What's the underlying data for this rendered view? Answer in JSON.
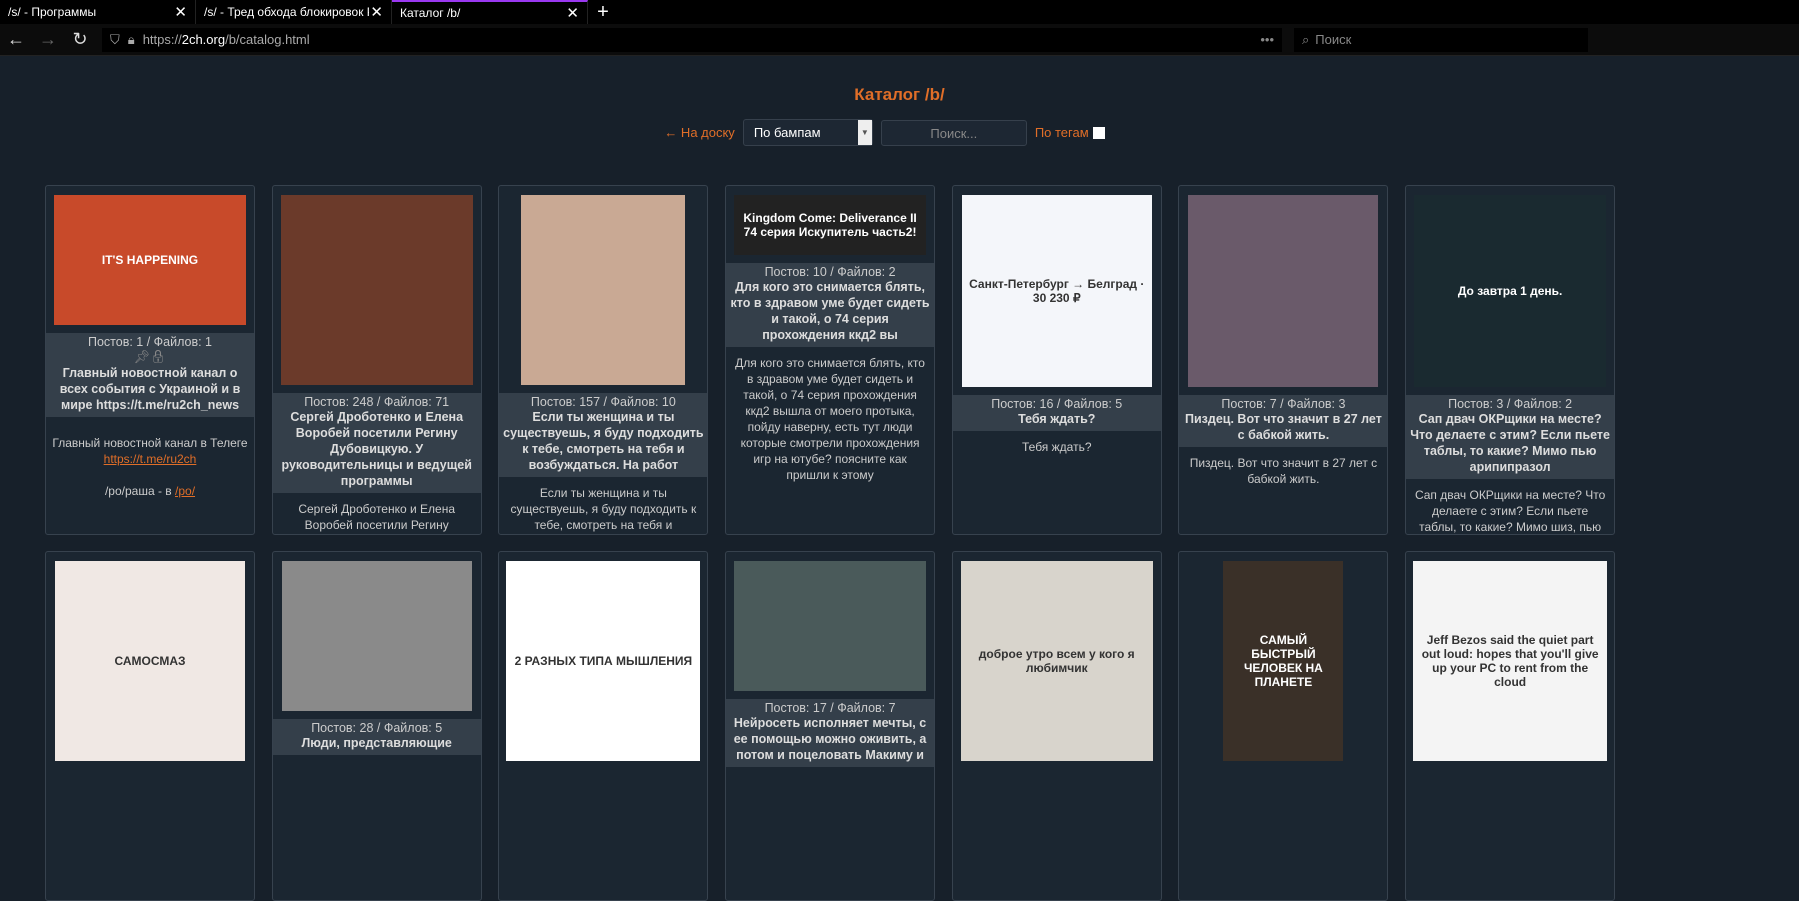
{
  "browser": {
    "tabs": [
      {
        "label": "/s/ - Программы"
      },
      {
        "label": "/s/ - Тред обхода блокировок PKH"
      },
      {
        "label": "Каталог /b/"
      }
    ],
    "url_prefix": "https://",
    "url_host": "2ch.org",
    "url_path": "/b/catalog.html",
    "search_placeholder": "Поиск",
    "close": "✕",
    "newtab": "+",
    "more": "•••"
  },
  "page": {
    "title": "Каталог /b/",
    "back_link": "← На доску",
    "sort_value": "По бампам",
    "search_placeholder": "Поиск...",
    "tags_label": "По тегам"
  },
  "threads": [
    {
      "meta": "Постов: 1 / Файлов: 1",
      "title": "Главный новостной канал о всех события с Украиной и в мире https://t.me/ru2ch_news",
      "body1": "Главный новостной канал в Телеге ",
      "link1": "https://t.me/ru2ch",
      "body2": "/ро/раша - в ",
      "link2": "/po/",
      "img_color": "#c84a2a",
      "img_text": "IT'S HAPPENING"
    },
    {
      "meta": "Постов: 248 / Файлов: 71",
      "title": "Сергей Дроботенко и Елена Воробей посетили Регину Дубовицкую. У руководительницы и ведущей программы",
      "body": "Сергей Дроботенко и Елена Воробей посетили Регину Дубовицкую. У руководительницы и ведущей",
      "img_color": "#6b3a2a"
    },
    {
      "meta": "Постов: 157 / Файлов: 10",
      "title": "Если ты женщина и ты существуешь, я буду подходить к тебе, смотреть на тебя и возбуждаться. На работ",
      "body": "Если ты женщина и ты существуешь, я буду подходить к тебе, смотреть на тебя и возбуждаться",
      "img_color": "#c9a994"
    },
    {
      "meta": "Постов: 10 / Файлов: 2",
      "title": "Для кого это снимается блять, кто в здравом уме будет сидеть и такой, о 74 серия прохождения ккд2 вы",
      "body": "Для кого это снимается блять, кто в здравом уме будет сидеть и такой, о 74 серия прохождения ккд2 вышла от моего протыка, пойду наверну, есть тут люди которые смотрели прохождения игр на ютубе? поясните как пришли к этому",
      "img_color": "#222",
      "img_text": "Kingdom Come: Deliverance II 74 серия Искупитель часть2!"
    },
    {
      "meta": "Постов: 16 / Файлов: 5",
      "title": "Тебя ждать?",
      "body": "Тебя ждать?",
      "img_color": "#f4f6fa",
      "img_text": "Санкт-Петербург → Белград · 30 230 ₽"
    },
    {
      "meta": "Постов: 7 / Файлов: 3",
      "title": "Пиздец. Вот что значит в 27 лет с бабкой жить.",
      "body": "Пиздец. Вот что значит в 27 лет с бабкой жить.",
      "img_color": "#6a5a6a"
    },
    {
      "meta": "Постов: 3 / Файлов: 2",
      "title": "Сап двач ОКРщики на месте? Что делаете с этим? Если пьете таблы, то какие? Мимо пью арипипразол",
      "body": "Сап двач ОКРщики на месте? Что делаете с этим? Если пьете таблы, то какие? Мимо шиз, пью арипипразол",
      "img_color": "#1a2a30",
      "img_text": "До завтра 1 день."
    },
    {
      "meta": "",
      "title": "",
      "body": "",
      "img_color": "#f0e8e4",
      "img_text": "САМОСМАЗ"
    },
    {
      "meta": "Постов: 28 / Файлов: 5",
      "title": "Люди, представляющие",
      "body": "",
      "img_color": "#8a8a8a"
    },
    {
      "meta": "",
      "title": "",
      "body": "",
      "img_color": "#ffffff",
      "img_text": "2 РАЗНЫХ ТИПА МЫШЛЕНИЯ"
    },
    {
      "meta": "Постов: 17 / Файлов: 7",
      "title": "Нейросеть исполняет мечты, с ее помощью можно оживить, а потом и поцеловать Макиму и",
      "body": "",
      "img_color": "#4a5a5a"
    },
    {
      "meta": "",
      "title": "",
      "body": "",
      "img_color": "#d8d4cc",
      "img_text": "доброе утро всем у кого я любимчик"
    },
    {
      "meta": "",
      "title": "",
      "body": "",
      "img_color": "#3a3028",
      "img_text": "САМЫЙ БЫСТРЫЙ ЧЕЛОВЕК НА ПЛАНЕТЕ"
    },
    {
      "meta": "",
      "title": "",
      "body": "",
      "img_color": "#f4f4f4",
      "img_text": "Jeff Bezos said the quiet part out loud: hopes that you'll give up your PC to rent from the cloud"
    }
  ]
}
